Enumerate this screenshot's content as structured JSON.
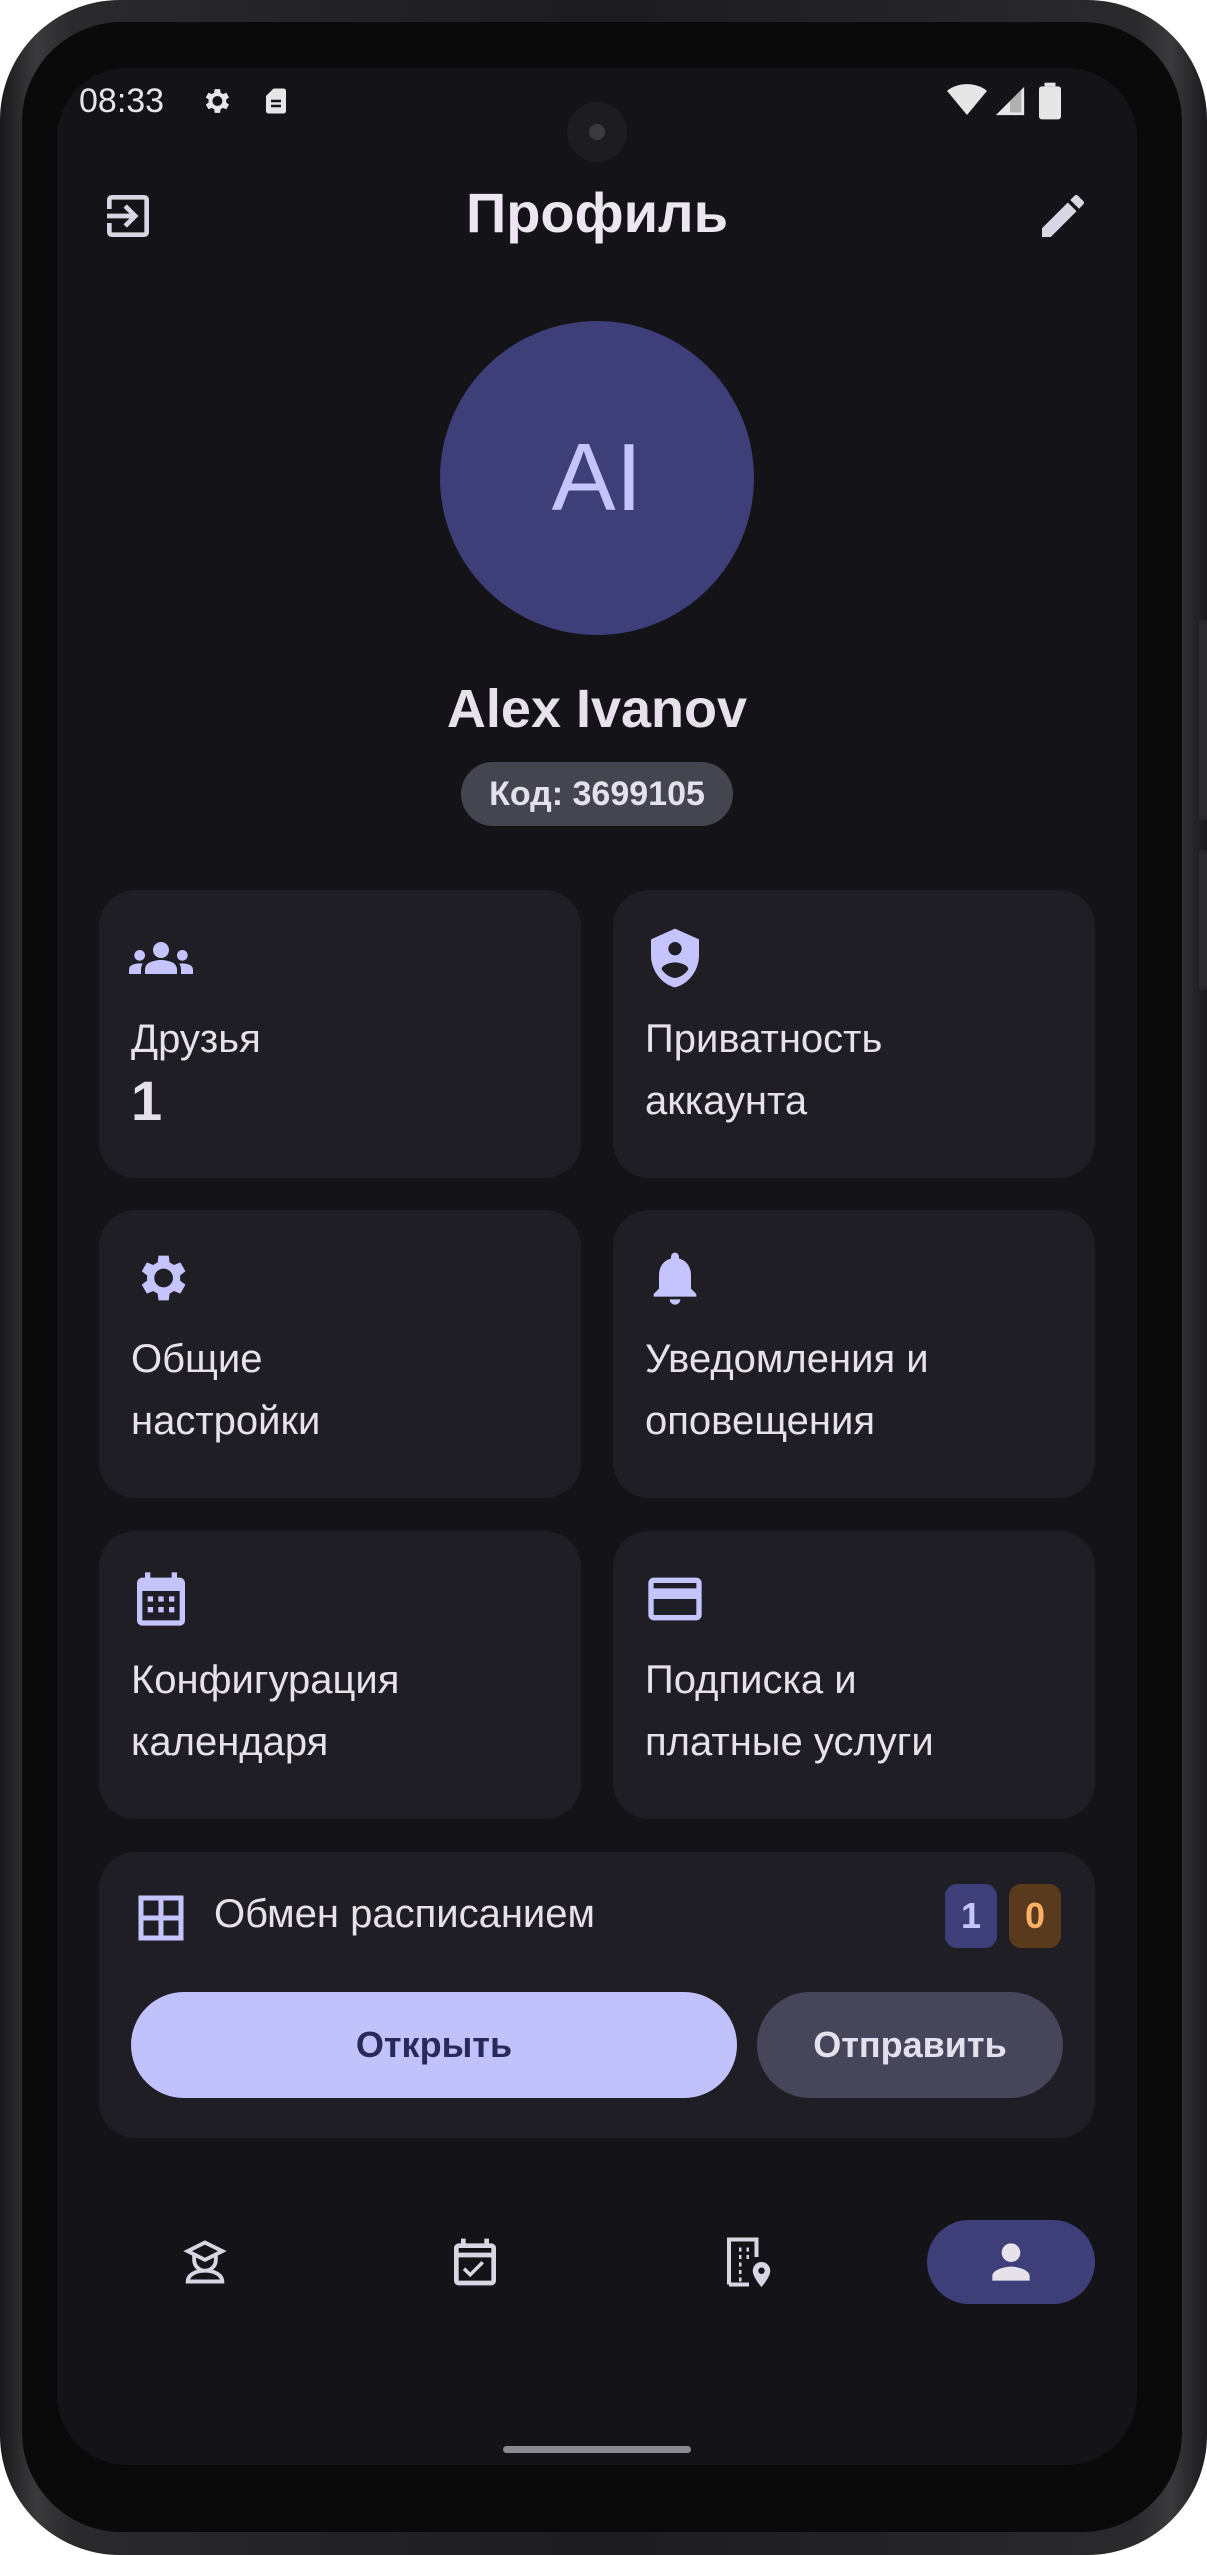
{
  "status_bar": {
    "time": "08:33",
    "icons": [
      "gear-icon",
      "sim-card-icon",
      "wifi-icon",
      "signal-icon",
      "battery-icon"
    ]
  },
  "app_bar": {
    "title": "Профиль",
    "left_icon": "logout-icon",
    "right_icon": "edit-pencil-icon"
  },
  "profile": {
    "initials": "AI",
    "name": "Alex Ivanov",
    "code": "Код: 3699105"
  },
  "cards": [
    {
      "icon": "group-icon",
      "title": "Друзья",
      "value": "1"
    },
    {
      "icon": "shield-person-icon",
      "title": "Приватность\nаккаунта"
    },
    {
      "icon": "gear-icon",
      "title": "Общие\nнастройки"
    },
    {
      "icon": "bell-icon",
      "title": "Уведомления и\nоповещения"
    },
    {
      "icon": "calendar-icon",
      "title": "Конфигурация\nкалендаря"
    },
    {
      "icon": "credit-card-icon",
      "title": "Подписка и\nплатные услуги"
    }
  ],
  "schedule_share": {
    "icon": "table-grid-icon",
    "title": "Обмен расписанием",
    "badge_incoming": "1",
    "badge_outgoing": "0",
    "open_label": "Открыть",
    "send_label": "Отправить"
  },
  "bottom_nav": {
    "items": [
      "student-icon",
      "calendar-check-icon",
      "building-location-icon",
      "person-icon"
    ],
    "active": "person-icon"
  },
  "colors": {
    "background": "#141318",
    "card": "#1f1e24",
    "accent": "#c1c1fb",
    "avatar": "#3e3e78",
    "badge_incoming": "#3e3e78",
    "badge_outgoing": "#5a3a1c"
  }
}
